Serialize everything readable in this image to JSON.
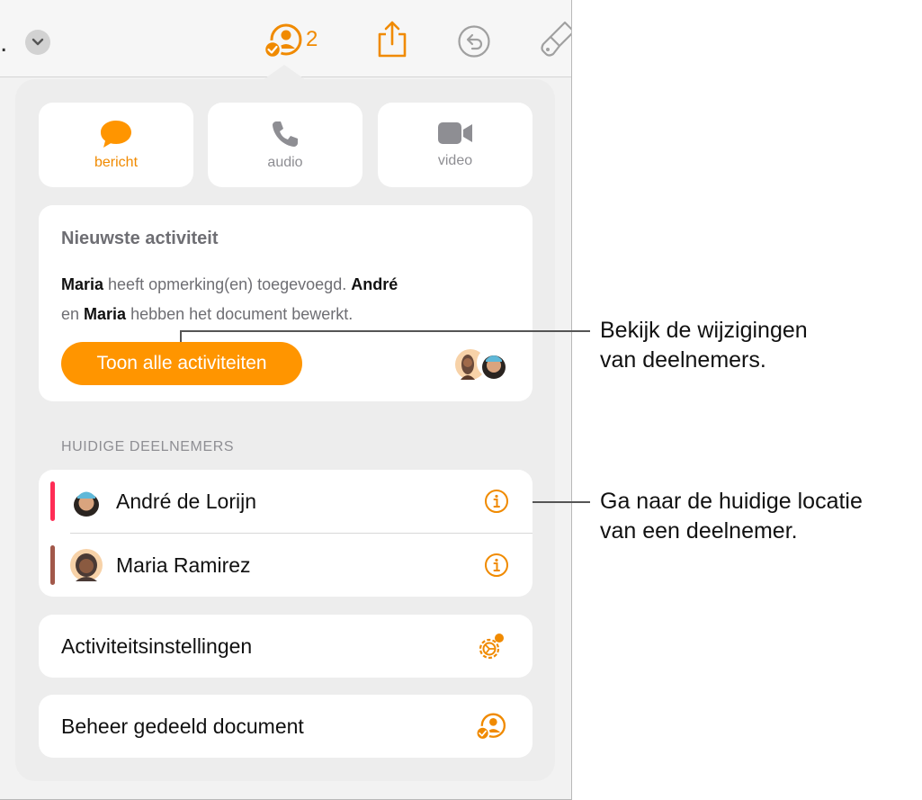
{
  "toolbar": {
    "collab_count": "2",
    "icons": [
      "more-dot",
      "chevron-down-icon",
      "collaborate-icon",
      "share-icon",
      "undo-icon",
      "format-brush-icon"
    ]
  },
  "comm": {
    "message_label": "bericht",
    "audio_label": "audio",
    "video_label": "video"
  },
  "activity": {
    "title": "Nieuwste activiteit",
    "name1": "Maria",
    "text1": " heeft opmerking(en) toegevoegd. ",
    "name2": "André",
    "text2": "en ",
    "name3": "Maria",
    "text3": " hebben het document bewerkt.",
    "button_label": "Toon alle activiteiten"
  },
  "participants": {
    "header": "HUIDIGE DEELNEMERS",
    "items": [
      {
        "name": "André de Lorijn",
        "color": "#ff2d55"
      },
      {
        "name": "Maria Ramirez",
        "color": "#a2584a"
      }
    ]
  },
  "options": {
    "settings_label": "Activiteitsinstellingen",
    "manage_label": "Beheer gedeeld document"
  },
  "callouts": {
    "first": [
      "Bekijk de wijzigingen",
      "van deelnemers."
    ],
    "second": [
      "Ga naar de huidige locatie",
      "van een deelnemer."
    ]
  },
  "colors": {
    "accent": "#ff9500",
    "accent_text": "#f08a00"
  }
}
